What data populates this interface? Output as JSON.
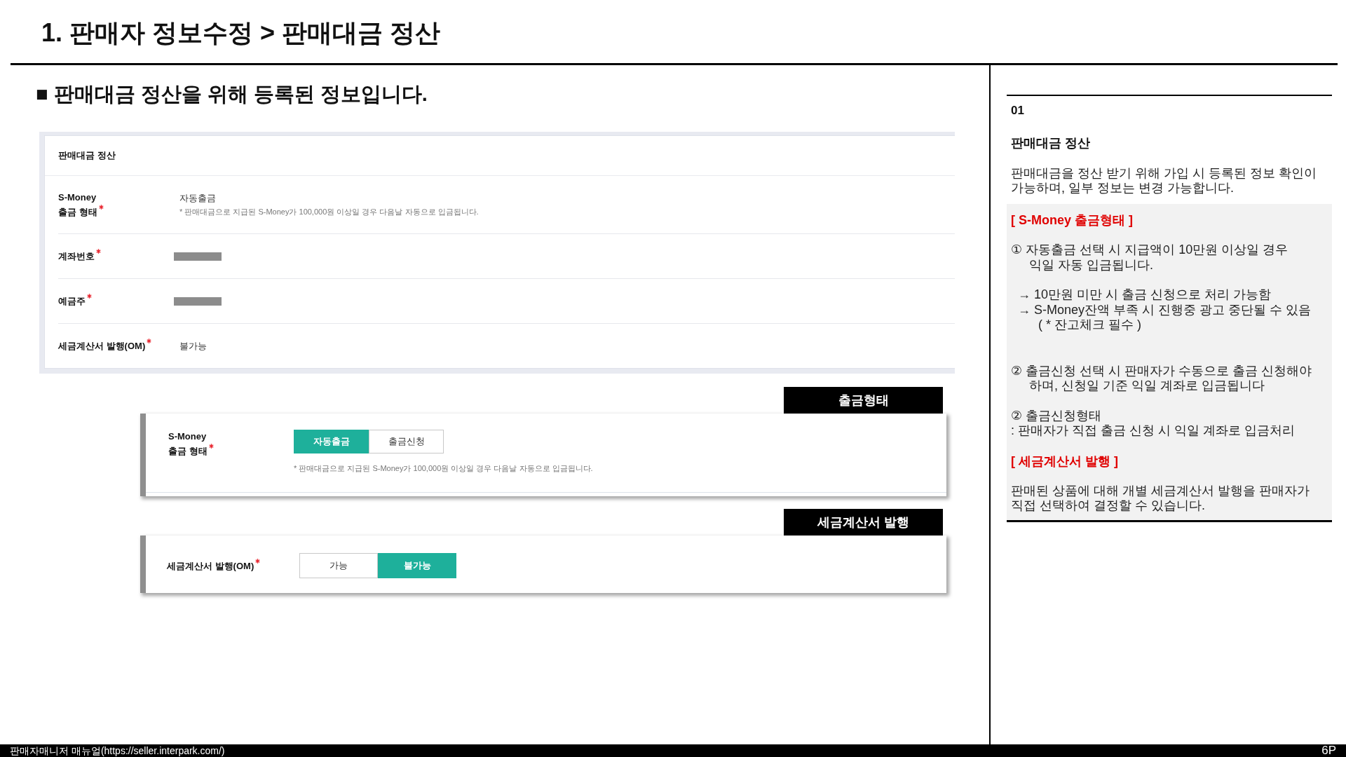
{
  "title": "1. 판매자 정보수정 > 판매대금 정산",
  "notice": "■ 판매대금 정산을 위해 등록된 정보입니다.",
  "settlement_panel": {
    "title": "판매대금 정산",
    "rows": [
      {
        "kind": "value_note",
        "label": "S-Money\n출금 형태",
        "required": true,
        "value": "자동출금",
        "note": "* 판매대금으로 지급된 S-Money가 100,000원 이상일 경우 다음날 자동으로 입금됩니다."
      },
      {
        "kind": "redacted",
        "label": "계좌번호",
        "required": true
      },
      {
        "kind": "redacted",
        "label": "예금주",
        "required": true
      },
      {
        "kind": "value",
        "label": "세금계산서 발행(OM)",
        "required": true,
        "value": "불가능"
      }
    ]
  },
  "withdrawal_form": {
    "callout": "출금형태",
    "label": "S-Money\n출금 형태",
    "required": true,
    "options": [
      {
        "label": "자동출금",
        "selected": true
      },
      {
        "label": "출금신청",
        "selected": false
      }
    ],
    "note": "* 판매대금으로 지급된 S-Money가 100,000원 이상일 경우 다음날 자동으로 입금됩니다."
  },
  "tax_form": {
    "callout": "세금계산서 발행",
    "label": "세금계산서 발행(OM)",
    "required": true,
    "options": [
      {
        "label": "가능",
        "selected": false
      },
      {
        "label": "불가능",
        "selected": true
      }
    ]
  },
  "description": {
    "number": "01",
    "title": "판매대금 정산",
    "intro": "판매대금을 정산 받기 위해 가입 시 등록된 정보 확인이 가능하며, 일부 정보는 변경 가능합니다.",
    "sections": [
      {
        "heading": "[ S-Money 출금형태 ]",
        "items": [
          {
            "kind": "numbered",
            "text": "① 자동출금 선택 시 지급액이 10만원 이상일 경우 익일 자동 입금됩니다."
          },
          {
            "kind": "arrow",
            "text": "→ 10만원 미만 시 출금 신청으로 처리 가능함"
          },
          {
            "kind": "arrow",
            "text": "→ S-Money잔액 부족 시 진행중 광고 중단될 수 있음 ( * 잔고체크 필수 )"
          },
          {
            "kind": "numbered",
            "text": "② 출금신청 선택 시 판매자가 수동으로 출금 신청해야 하며, 신청일 기준 익일 계좌로 입금됩니다"
          },
          {
            "kind": "numbered",
            "text": "② 출금신청형태"
          },
          {
            "kind": "plain",
            "text": ": 판매자가 직접 출금 신청 시 익일 계좌로 입금처리"
          }
        ]
      },
      {
        "heading": "[ 세금계산서 발행 ]",
        "items": [
          {
            "kind": "plain",
            "text": "판매된 상품에 대해 개별 세금계산서 발행을 판매자가 직접 선택하여 결정할 수 있습니다."
          }
        ]
      }
    ]
  },
  "footer": {
    "text": "판매자매니저 매뉴얼(https://seller.interpark.com/)",
    "page": "6P"
  }
}
